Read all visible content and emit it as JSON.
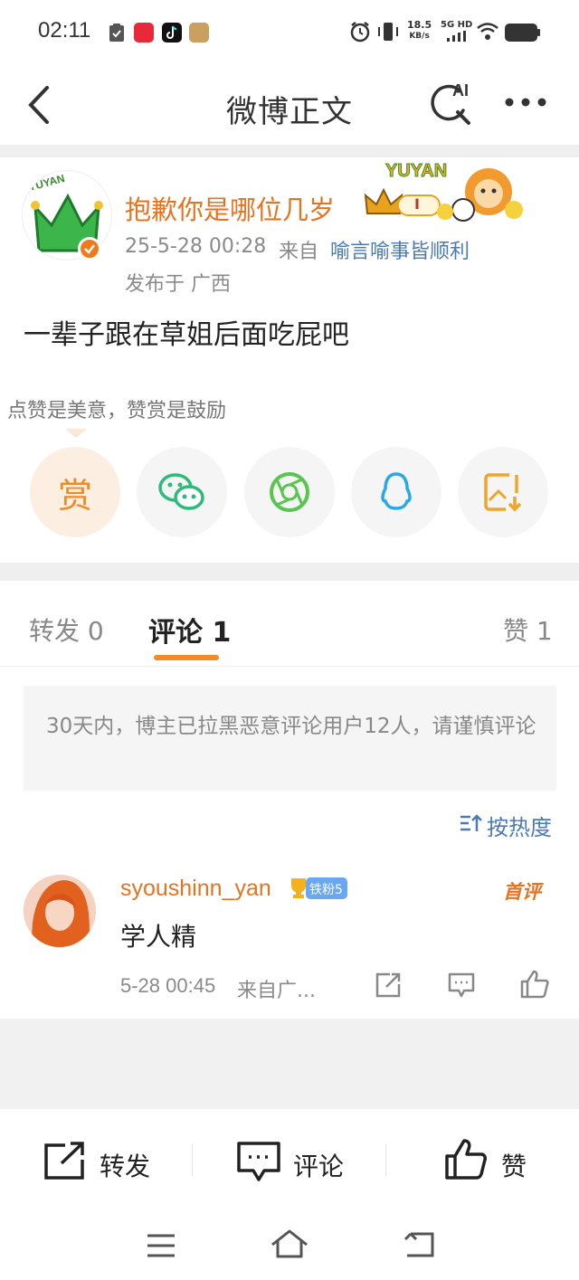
{
  "status_bar": {
    "time": "02:11",
    "speed_top": "18.5",
    "speed_bottom": "KB/s",
    "network_top": "5G HD"
  },
  "nav": {
    "title": "微博正文",
    "ai_label": "AI"
  },
  "post": {
    "author": "抱歉你是哪位几岁",
    "avatar_text": "YUYAN",
    "time": "25-5-28 00:28",
    "source_label": "来自",
    "source": "喻言喻事皆顺利",
    "location": "发布于 广西",
    "text": "一辈子跟在草姐后面吃屁吧",
    "badge_text": "YUYAN",
    "level_text": "I"
  },
  "share": {
    "tip": "点赞是美意，赞赏是鼓励",
    "reward_label": "赏"
  },
  "tabs": {
    "repost": "转发 0",
    "comment": "评论 1",
    "like": "赞 1"
  },
  "notice": "30天内，博主已拉黑恶意评论用户12人，请谨慎评论",
  "sort_label": "按热度",
  "comment": {
    "username": "syoushinn_yan",
    "fan_badge": "铁粉5",
    "first_tag": "首评",
    "text": "学人精",
    "time": "5-28 00:45",
    "from": "来自广..."
  },
  "bottom_bar": {
    "repost": "转发",
    "comment": "评论",
    "like": "赞"
  },
  "colors": {
    "accent_orange": "#e8731f",
    "link_blue": "#4a7bb7",
    "tab_underline": "#f28c28",
    "wechat_green": "#2dbb7a",
    "moments_green": "#57c54e",
    "qq_blue": "#2aa8e6"
  }
}
